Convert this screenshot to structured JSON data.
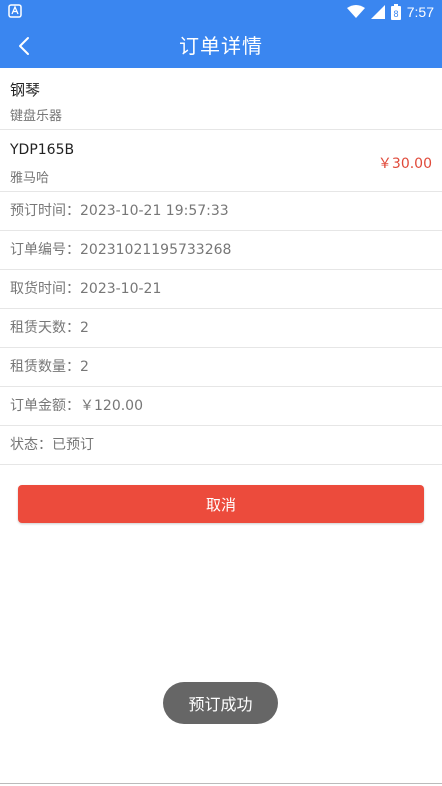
{
  "status_bar": {
    "time": "7:57",
    "battery": "8"
  },
  "app_bar": {
    "title": "订单详情"
  },
  "product": {
    "name": "钢琴",
    "category": "键盘乐器"
  },
  "item": {
    "model": "YDP165B",
    "brand": "雅马哈",
    "price": "￥30.00"
  },
  "info": [
    {
      "label": "预订时间：",
      "value": "2023-10-21 19:57:33"
    },
    {
      "label": "订单编号：",
      "value": "20231021195733268"
    },
    {
      "label": "取货时间：",
      "value": "2023-10-21"
    },
    {
      "label": "租赁天数：",
      "value": "2"
    },
    {
      "label": "租赁数量：",
      "value": "2"
    },
    {
      "label": "订单金额：",
      "value": "￥120.00"
    },
    {
      "label": "状态：",
      "value": "已预订"
    }
  ],
  "actions": {
    "cancel_label": "取消"
  },
  "toast": {
    "message": "预订成功"
  },
  "colors": {
    "primary": "#3a86f0",
    "danger": "#ec4b3c",
    "price": "#e04a3a"
  }
}
